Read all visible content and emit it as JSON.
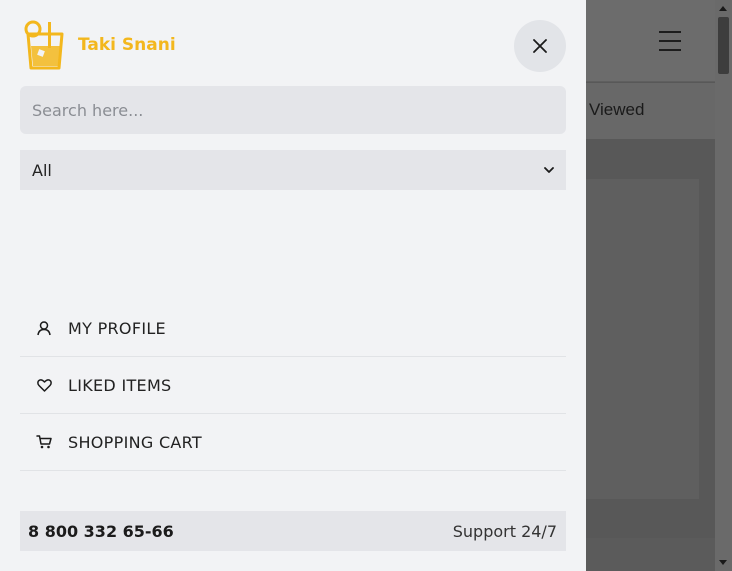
{
  "brand": {
    "name": "Taki Snani",
    "accent_color": "#f3b71d"
  },
  "drawer": {
    "search_placeholder": "Search here...",
    "category_selected": "All",
    "menu": [
      {
        "label": "MY PROFILE",
        "icon": "user-icon"
      },
      {
        "label": "LIKED ITEMS",
        "icon": "heart-icon"
      },
      {
        "label": "SHOPPING CART",
        "icon": "cart-icon"
      }
    ],
    "support": {
      "phone": "8 800 332 65-66",
      "label": "Support 24/7"
    }
  },
  "background_page": {
    "tab_text": "ly Viewed"
  }
}
